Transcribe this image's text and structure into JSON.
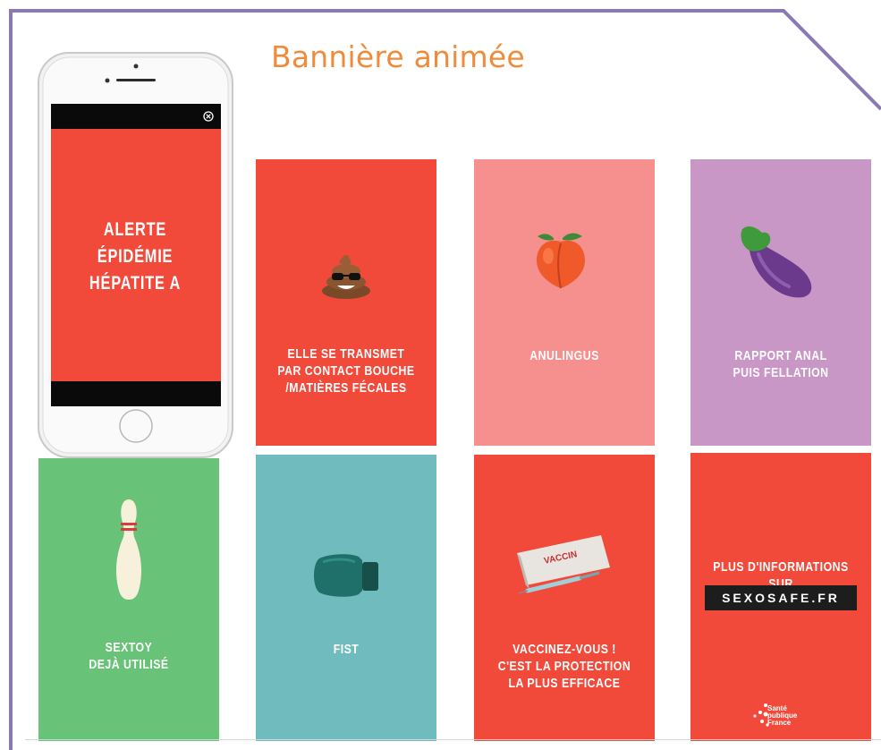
{
  "header": {
    "title": "Bannière animée"
  },
  "phone": {
    "screen_text": "ALERTE\nÉPIDÉMIE\nHÉPATITE A"
  },
  "cards": [
    {
      "label": "ELLE SE TRANSMET\nPAR CONTACT BOUCHE\n/MATIÈRES FÉCALES",
      "icon": "poop-sunglasses-icon",
      "color": "#f24a3a"
    },
    {
      "label": "ANULINGUS",
      "icon": "peach-icon",
      "color": "#f6908e"
    },
    {
      "label": "RAPPORT ANAL\nPUIS FELLATION",
      "icon": "eggplant-icon",
      "color": "#c997c6"
    },
    {
      "label": "SEXTOY\nDEJÀ UTILISÉ",
      "icon": "bowling-pin-icon",
      "color": "#68c277"
    },
    {
      "label": "FIST",
      "icon": "boxing-glove-icon",
      "color": "#6fbbbd"
    },
    {
      "label": "VACCINEZ-VOUS !\nC'EST LA PROTECTION\nLA PLUS EFFICACE",
      "icon": "vaccine-icon",
      "color": "#f24a3a",
      "vaccine_box_text": "VACCIN"
    },
    {
      "label": "PLUS D'INFORMATIONS SUR",
      "icon": "sexosafe-logo",
      "color": "#f24a3a",
      "logo_text": "SEXOSAFE.FR",
      "footer_logo": "Santé\npublique\nFrance"
    }
  ],
  "colors": {
    "title": "#ef8c3c",
    "frame": "#8b79b4",
    "red": "#f24a3a"
  }
}
